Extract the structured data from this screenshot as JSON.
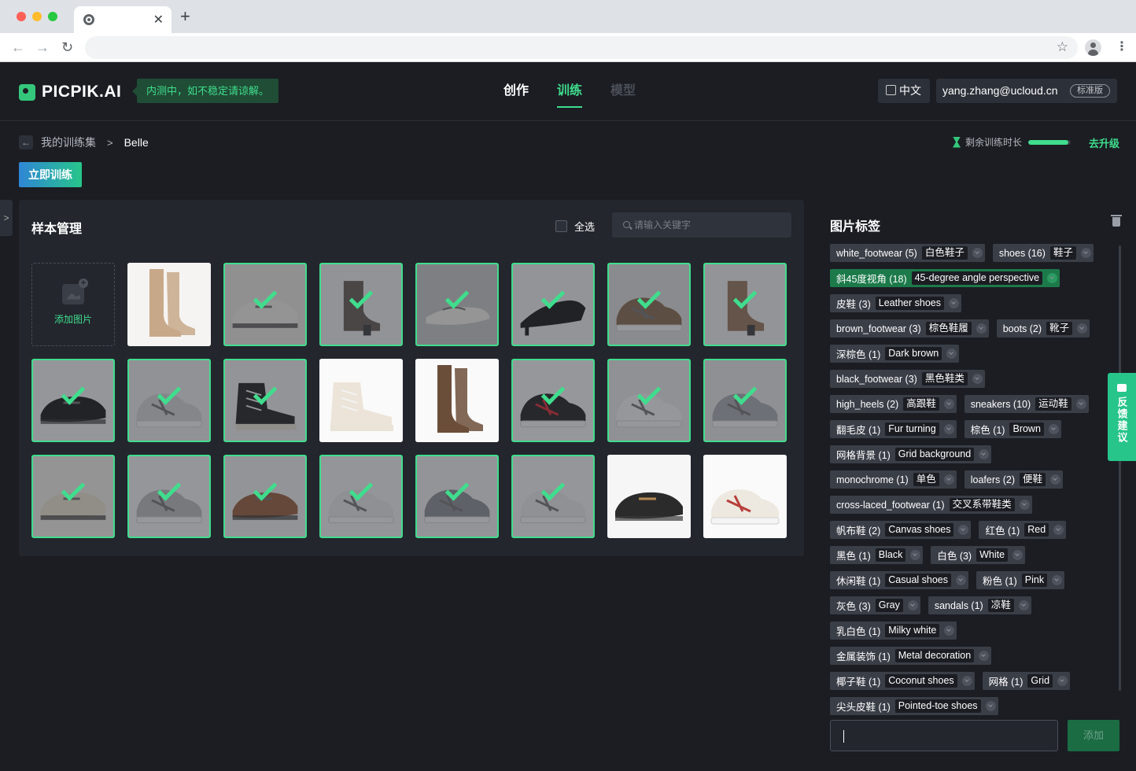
{
  "browser": {
    "tab_close": "✕",
    "new_tab": "+",
    "back": "←",
    "forward": "→",
    "reload": "↻",
    "star": "☆",
    "menu": "⋮"
  },
  "header": {
    "logo": "PICPIK.AI",
    "beta_notice": "内测中，如不稳定请谅解。",
    "nav": {
      "create": "创作",
      "train": "训练",
      "model": "模型"
    },
    "language": "中文",
    "user_email": "yang.zhang@ucloud.cn",
    "plan": "标准版"
  },
  "breadcrumb": {
    "back": "←",
    "parent": "我的训练集",
    "separator": ">",
    "current": "Belle"
  },
  "quota": {
    "label": "剩余训练时长",
    "fill_fraction": 0.95,
    "upgrade": "去升级"
  },
  "train_button": "立即训练",
  "sidebar_toggle": ">",
  "samples": {
    "title": "样本管理",
    "select_all": "全选",
    "search_placeholder": "请输入关键字",
    "add_label": "添加图片",
    "items": [
      {
        "shoe": "tall-boot-tan",
        "selected": false
      },
      {
        "shoe": "loafer-white",
        "selected": true
      },
      {
        "shoe": "ankle-boot-gray",
        "selected": true
      },
      {
        "shoe": "mary-jane-white",
        "selected": true
      },
      {
        "shoe": "pump-black",
        "selected": true
      },
      {
        "shoe": "sneaker-brown",
        "selected": true
      },
      {
        "shoe": "ankle-boot-brown",
        "selected": true
      },
      {
        "shoe": "loafer-black",
        "selected": true
      },
      {
        "shoe": "sneaker-white-gray",
        "selected": true
      },
      {
        "shoe": "hightop-black",
        "selected": true
      },
      {
        "shoe": "hightop-white",
        "selected": false
      },
      {
        "shoe": "tall-boot-brown",
        "selected": false
      },
      {
        "shoe": "sneaker-black-red",
        "selected": true
      },
      {
        "shoe": "sneaker-white",
        "selected": true
      },
      {
        "shoe": "sneaker-gray",
        "selected": true
      },
      {
        "shoe": "loafer-cream",
        "selected": true
      },
      {
        "shoe": "sneaker-pattern",
        "selected": true
      },
      {
        "shoe": "loafer-brown",
        "selected": true
      },
      {
        "shoe": "velcro-white",
        "selected": true
      },
      {
        "shoe": "sneaker-silver",
        "selected": true
      },
      {
        "shoe": "sneaker-white-green",
        "selected": true
      },
      {
        "shoe": "derby-black",
        "selected": false
      },
      {
        "shoe": "chunky-sneaker",
        "selected": false
      }
    ]
  },
  "tags": {
    "title": "图片标签",
    "rows": [
      [
        {
          "name": "white_footwear (5)",
          "trans": "白色鞋子"
        },
        {
          "name": "shoes (16)",
          "trans": "鞋子"
        }
      ],
      [
        {
          "name": "斜45度视角 (18)",
          "trans": "45-degree angle perspective",
          "active": true
        }
      ],
      [
        {
          "name": "皮鞋 (3)",
          "trans": "Leather shoes"
        }
      ],
      [
        {
          "name": "brown_footwear (3)",
          "trans": "棕色鞋履"
        },
        {
          "name": "boots (2)",
          "trans": "靴子"
        }
      ],
      [
        {
          "name": "深棕色 (1)",
          "trans": "Dark brown"
        }
      ],
      [
        {
          "name": "black_footwear (3)",
          "trans": "黑色鞋类"
        }
      ],
      [
        {
          "name": "high_heels (2)",
          "trans": "高跟鞋"
        },
        {
          "name": "sneakers (10)",
          "trans": "运动鞋"
        }
      ],
      [
        {
          "name": "翻毛皮 (1)",
          "trans": "Fur turning"
        },
        {
          "name": "棕色 (1)",
          "trans": "Brown"
        }
      ],
      [
        {
          "name": "网格背景 (1)",
          "trans": "Grid background"
        }
      ],
      [
        {
          "name": "monochrome (1)",
          "trans": "单色"
        },
        {
          "name": "loafers (2)",
          "trans": "便鞋"
        }
      ],
      [
        {
          "name": "cross-laced_footwear (1)",
          "trans": "交叉系带鞋类"
        }
      ],
      [
        {
          "name": "帆布鞋 (2)",
          "trans": "Canvas shoes"
        },
        {
          "name": "红色 (1)",
          "trans": "Red"
        }
      ],
      [
        {
          "name": "黑色 (1)",
          "trans": "Black"
        },
        {
          "name": "白色 (3)",
          "trans": "White"
        }
      ],
      [
        {
          "name": "休闲鞋 (1)",
          "trans": "Casual shoes"
        },
        {
          "name": "粉色 (1)",
          "trans": "Pink"
        }
      ],
      [
        {
          "name": "灰色 (3)",
          "trans": "Gray"
        },
        {
          "name": "sandals (1)",
          "trans": "凉鞋"
        }
      ],
      [
        {
          "name": "乳白色 (1)",
          "trans": "Milky white"
        }
      ],
      [
        {
          "name": "金属装饰 (1)",
          "trans": "Metal decoration"
        }
      ],
      [
        {
          "name": "椰子鞋 (1)",
          "trans": "Coconut shoes"
        },
        {
          "name": "网格 (1)",
          "trans": "Grid"
        }
      ],
      [
        {
          "name": "尖头皮鞋 (1)",
          "trans": "Pointed-toe shoes"
        }
      ]
    ],
    "input_value": "",
    "add_button": "添加"
  },
  "feedback": "反馈建议",
  "colors": {
    "accent": "#3fdd8d",
    "background": "#1b1d23",
    "panel": "#23262d",
    "tag": "#3a3e47",
    "tag_active": "#1c7a4a"
  }
}
